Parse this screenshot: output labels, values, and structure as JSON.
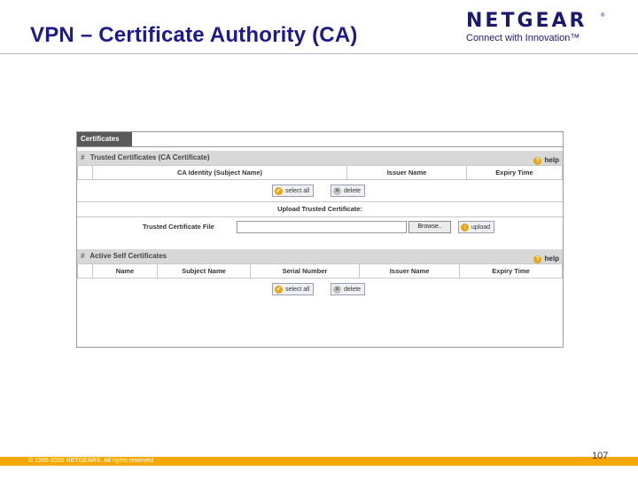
{
  "slide": {
    "title": "VPN – Certificate Authority (CA)",
    "page_number": "107",
    "footer": "© 1996-2006 NETGEAR®. All rights reserved"
  },
  "logo": {
    "word": "NETGEAR",
    "tagline": "Connect with Innovation™",
    "registered": "®"
  },
  "ui": {
    "tab_label": "Certificates",
    "trusted": {
      "section_title": "Trusted Certificates (CA Certificate)",
      "help_label": "help",
      "columns": [
        "CA Identity (Subject Name)",
        "Issuer Name",
        "Expiry Time"
      ],
      "select_all_label": "select all",
      "delete_label": "delete",
      "upload_heading": "Upload Trusted Certificate:",
      "upload_label": "Trusted Certificate File",
      "browse_label": "Browse..",
      "upload_button_label": "upload"
    },
    "self": {
      "section_title": "Active Self Certificates",
      "help_label": "help",
      "columns": [
        "Name",
        "Subject Name",
        "Serial Number",
        "Issuer Name",
        "Expiry Time"
      ],
      "select_all_label": "select all",
      "delete_label": "delete"
    }
  },
  "colors": {
    "title": "#1f1a8c",
    "footer_bar": "#f7a800",
    "tab": "#5a5a5a",
    "section_bar": "#d8d8d8"
  }
}
